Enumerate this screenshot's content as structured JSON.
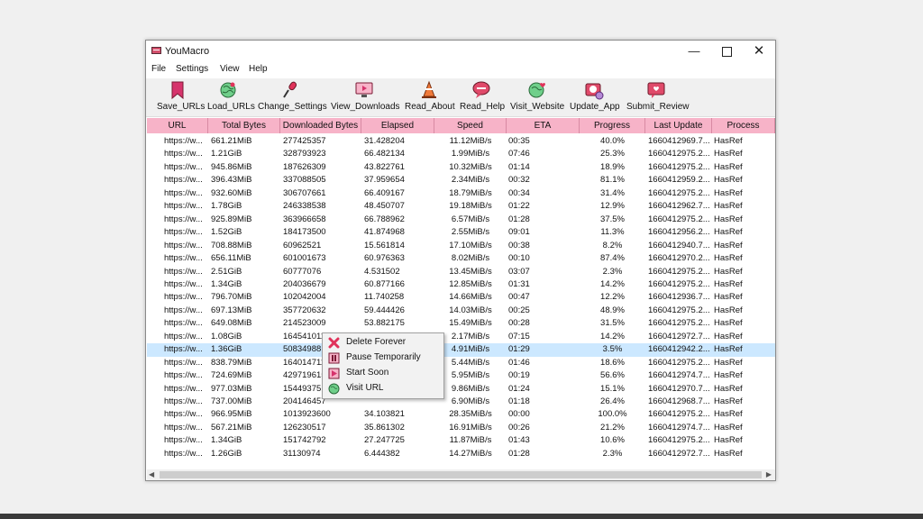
{
  "window": {
    "title": "YouMacro",
    "controls": {
      "minimize": "—",
      "close": "✕"
    }
  },
  "menu": [
    "File",
    "Settings",
    "View",
    "Help"
  ],
  "toolbar": [
    {
      "label": "Save_URLs",
      "icon": "bookmark-icon",
      "color": "#d6336c"
    },
    {
      "label": "Load_URLs",
      "icon": "globe-icon",
      "color": "#3aa65a"
    },
    {
      "label": "Change_Settings",
      "icon": "microphone-icon",
      "color": "#e0325a"
    },
    {
      "label": "View_Downloads",
      "icon": "monitor-icon",
      "color": "#d6336c"
    },
    {
      "label": "Read_About",
      "icon": "traffic-cone-icon",
      "color": "#e05a2a"
    },
    {
      "label": "Read_Help",
      "icon": "help-bubble-icon",
      "color": "#e04a6a"
    },
    {
      "label": "Visit_Website",
      "icon": "globe-heart-icon",
      "color": "#3aa65a"
    },
    {
      "label": "Update_App",
      "icon": "camera-update-icon",
      "color": "#d6336c"
    },
    {
      "label": "Submit_Review",
      "icon": "heart-message-icon",
      "color": "#d6336c"
    }
  ],
  "table": {
    "columns": [
      "URL",
      "Total Bytes",
      "Downloaded Bytes",
      "Elapsed",
      "Speed",
      "ETA",
      "Progress",
      "Last Update",
      "Process"
    ],
    "rows": [
      [
        "https://w...",
        "661.21MiB",
        "277425357",
        "31.428204",
        "11.12MiB/s",
        "00:35",
        "40.0%",
        "1660412969.7...",
        "HasRef"
      ],
      [
        "https://w...",
        "1.21GiB",
        "328793923",
        "66.482134",
        "1.99MiB/s",
        "07:46",
        "25.3%",
        "1660412975.2...",
        "HasRef"
      ],
      [
        "https://w...",
        "945.86MiB",
        "187626309",
        "43.822761",
        "10.32MiB/s",
        "01:14",
        "18.9%",
        "1660412975.2...",
        "HasRef"
      ],
      [
        "https://w...",
        "396.43MiB",
        "337088505",
        "37.959654",
        "2.34MiB/s",
        "00:32",
        "81.1%",
        "1660412959.2...",
        "HasRef"
      ],
      [
        "https://w...",
        "932.60MiB",
        "306707661",
        "66.409167",
        "18.79MiB/s",
        "00:34",
        "31.4%",
        "1660412975.2...",
        "HasRef"
      ],
      [
        "https://w...",
        "1.78GiB",
        "246338538",
        "48.450707",
        "19.18MiB/s",
        "01:22",
        "12.9%",
        "1660412962.7...",
        "HasRef"
      ],
      [
        "https://w...",
        "925.89MiB",
        "363966658",
        "66.788962",
        "6.57MiB/s",
        "01:28",
        "37.5%",
        "1660412975.2...",
        "HasRef"
      ],
      [
        "https://w...",
        "1.52GiB",
        "184173500",
        "41.874968",
        "2.55MiB/s",
        "09:01",
        "11.3%",
        "1660412956.2...",
        "HasRef"
      ],
      [
        "https://w...",
        "708.88MiB",
        "60962521",
        "15.561814",
        "17.10MiB/s",
        "00:38",
        "8.2%",
        "1660412940.7...",
        "HasRef"
      ],
      [
        "https://w...",
        "656.11MiB",
        "601001673",
        "60.976363",
        "8.02MiB/s",
        "00:10",
        "87.4%",
        "1660412970.2...",
        "HasRef"
      ],
      [
        "https://w...",
        "2.51GiB",
        "60777076",
        "4.531502",
        "13.45MiB/s",
        "03:07",
        "2.3%",
        "1660412975.2...",
        "HasRef"
      ],
      [
        "https://w...",
        "1.34GiB",
        "204036679",
        "60.877166",
        "12.85MiB/s",
        "01:31",
        "14.2%",
        "1660412975.2...",
        "HasRef"
      ],
      [
        "https://w...",
        "796.70MiB",
        "102042004",
        "11.740258",
        "14.66MiB/s",
        "00:47",
        "12.2%",
        "1660412936.7...",
        "HasRef"
      ],
      [
        "https://w...",
        "697.13MiB",
        "357720632",
        "59.444426",
        "14.03MiB/s",
        "00:25",
        "48.9%",
        "1660412975.2...",
        "HasRef"
      ],
      [
        "https://w...",
        "649.08MiB",
        "214523009",
        "53.882175",
        "15.49MiB/s",
        "00:28",
        "31.5%",
        "1660412975.2...",
        "HasRef"
      ],
      [
        "https://w...",
        "1.08GiB",
        "164541011",
        "",
        "2.17MiB/s",
        "07:15",
        "14.2%",
        "1660412972.7...",
        "HasRef"
      ],
      [
        "https://w...",
        "1.36GiB",
        "50834988",
        "",
        "4.91MiB/s",
        "01:29",
        "3.5%",
        "1660412942.2...",
        "HasRef"
      ],
      [
        "https://w...",
        "838.79MiB",
        "164014711",
        "",
        "5.44MiB/s",
        "01:46",
        "18.6%",
        "1660412975.2...",
        "HasRef"
      ],
      [
        "https://w...",
        "724.69MiB",
        "429719615",
        "",
        "5.95MiB/s",
        "00:19",
        "56.6%",
        "1660412974.7...",
        "HasRef"
      ],
      [
        "https://w...",
        "977.03MiB",
        "154493751",
        "",
        "9.86MiB/s",
        "01:24",
        "15.1%",
        "1660412970.7...",
        "HasRef"
      ],
      [
        "https://w...",
        "737.00MiB",
        "204146457",
        "",
        "6.90MiB/s",
        "01:18",
        "26.4%",
        "1660412968.7...",
        "HasRef"
      ],
      [
        "https://w...",
        "966.95MiB",
        "1013923600",
        "34.103821",
        "28.35MiB/s",
        "00:00",
        "100.0%",
        "1660412975.2...",
        "HasRef"
      ],
      [
        "https://w...",
        "567.21MiB",
        "126230517",
        "35.861302",
        "16.91MiB/s",
        "00:26",
        "21.2%",
        "1660412974.7...",
        "HasRef"
      ],
      [
        "https://w...",
        "1.34GiB",
        "151742792",
        "27.247725",
        "11.87MiB/s",
        "01:43",
        "10.6%",
        "1660412975.2...",
        "HasRef"
      ],
      [
        "https://w...",
        "1.26GiB",
        "31130974",
        "6.444382",
        "14.27MiB/s",
        "01:28",
        "2.3%",
        "1660412972.7...",
        "HasRef"
      ]
    ],
    "selected_row": 16
  },
  "context_menu": [
    {
      "label": "Delete Forever",
      "icon": "delete-x-icon",
      "color": "#e0325a"
    },
    {
      "label": "Pause Temporarily",
      "icon": "pause-icon",
      "color": "#c0607a"
    },
    {
      "label": "Start Soon",
      "icon": "play-icon",
      "color": "#c0607a"
    },
    {
      "label": "Visit URL",
      "icon": "globe-icon",
      "color": "#3aa65a"
    }
  ],
  "colors": {
    "header_bg": "#f7b3c8",
    "selected_row": "#cce8ff",
    "accent": "#d6336c"
  }
}
